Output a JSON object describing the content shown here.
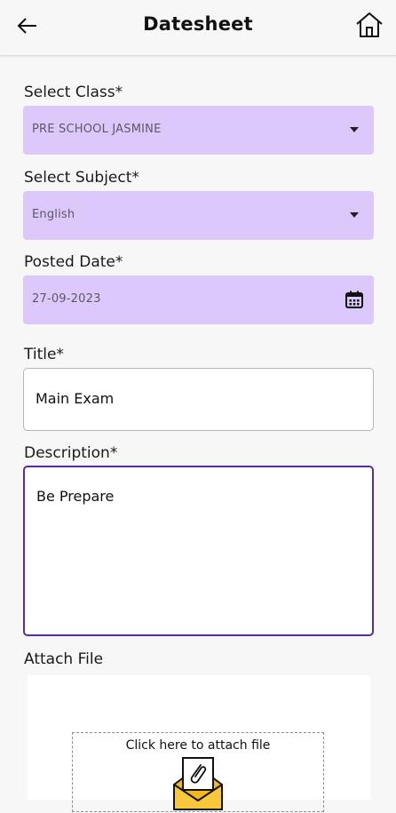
{
  "header": {
    "title": "Datesheet",
    "back_icon": "arrow-left-icon",
    "home_icon": "home-icon"
  },
  "form": {
    "class": {
      "label": "Select Class*",
      "value": "PRE SCHOOL JASMINE"
    },
    "subject": {
      "label": "Select Subject*",
      "value": "English"
    },
    "posted_date": {
      "label": "Posted Date*",
      "value": "27-09-2023",
      "icon": "calendar-icon"
    },
    "title": {
      "label": "Title*",
      "value": "Main Exam"
    },
    "description": {
      "label": "Description*",
      "value": "Be Prepare"
    },
    "attach": {
      "label": "Attach File",
      "prompt": "Click here to attach file",
      "icon": "envelope-attachment-icon"
    }
  },
  "colors": {
    "select_bg": "#dcc8fb",
    "focus_border": "#5a2ba8",
    "envelope": "#f5b81c"
  }
}
